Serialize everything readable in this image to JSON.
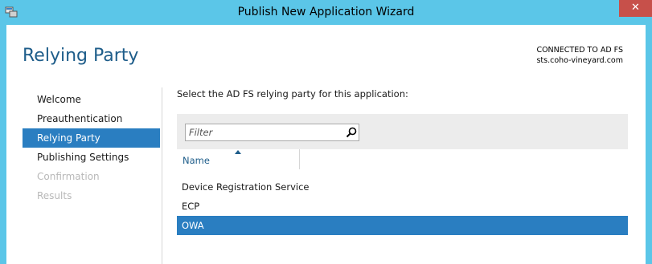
{
  "window": {
    "title": "Publish New Application Wizard",
    "close_glyph": "✕",
    "app_icon": "wizard-app-icon"
  },
  "page": {
    "title": "Relying Party",
    "connection_line1": "CONNECTED TO AD FS",
    "connection_line2": "sts.coho-vineyard.com"
  },
  "nav": {
    "items": [
      {
        "label": "Welcome",
        "state": "normal"
      },
      {
        "label": "Preauthentication",
        "state": "normal"
      },
      {
        "label": "Relying Party",
        "state": "selected"
      },
      {
        "label": "Publishing Settings",
        "state": "normal"
      },
      {
        "label": "Confirmation",
        "state": "disabled"
      },
      {
        "label": "Results",
        "state": "disabled"
      }
    ]
  },
  "main": {
    "instruction": "Select the AD FS relying party for this application:",
    "filter": {
      "placeholder": "Filter",
      "value": ""
    },
    "columns": [
      {
        "label": "Name",
        "sort": "ascending"
      }
    ],
    "rows": [
      {
        "name": "Device Registration Service",
        "selected": false
      },
      {
        "name": "ECP",
        "selected": false
      },
      {
        "name": "OWA",
        "selected": true
      }
    ]
  },
  "colors": {
    "titlebar": "#5bc6e8",
    "accent_selection": "#2a7ec1",
    "title_text": "#1e5d8a",
    "close_button": "#c7504a"
  }
}
